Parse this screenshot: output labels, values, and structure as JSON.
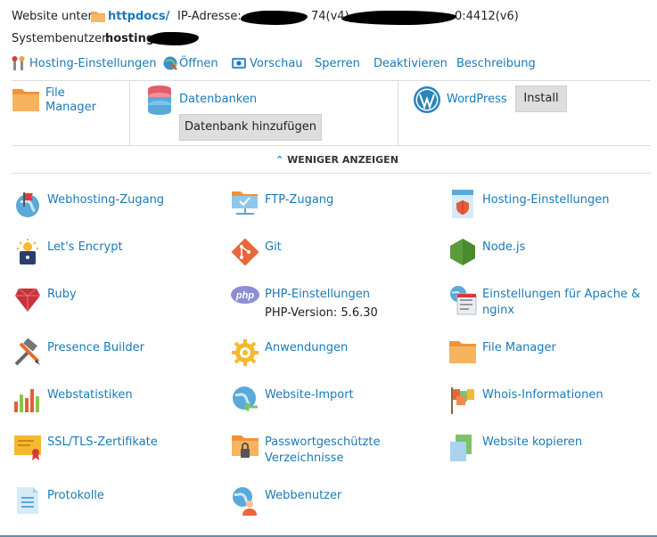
{
  "header": {
    "website_label": "Website unter",
    "httpdocs_link": "httpdocs/",
    "ip_label": "IP-Adresse:",
    "ip_v4_suffix": "74(v4),",
    "ip_v6_suffix": "0:4412(v6)",
    "sysuser_label": "Systembenutzer:",
    "sysuser_value": "hosting"
  },
  "toolbar": {
    "hosting": "Hosting-Einstellungen",
    "open": "Öffnen",
    "preview": "Vorschau",
    "lock": "Sperren",
    "deactivate": "Deaktivieren",
    "description": "Beschreibung"
  },
  "quick": {
    "file_manager_l1": "File",
    "file_manager_l2": "Manager",
    "databases": "Datenbanken",
    "add_db": "Datenbank hinzufügen",
    "wordpress": "WordPress",
    "install": "Install"
  },
  "toggle": {
    "label": "WENIGER ANZEIGEN"
  },
  "features": {
    "webhosting": "Webhosting-Zugang",
    "ftp": "FTP-Zugang",
    "hosting_settings": "Hosting-Einstellungen",
    "letsencrypt": "Let's Encrypt",
    "git": "Git",
    "nodejs": "Node.js",
    "ruby": "Ruby",
    "php": "PHP-Einstellungen",
    "php_version": "PHP-Version: 5.6.30",
    "apache_l1": "Einstellungen für Apache &",
    "apache_l2": "nginx",
    "presence": "Presence Builder",
    "apps": "Anwendungen",
    "filemanager": "File Manager",
    "webstats": "Webstatistiken",
    "import": "Website-Import",
    "whois": "Whois-Informationen",
    "ssl": "SSL/TLS-Zertifikate",
    "pw_dirs_l1": "Passwortgeschützte",
    "pw_dirs_l2": "Verzeichnisse",
    "copy": "Website kopieren",
    "logs": "Protokolle",
    "webusers": "Webbenutzer",
    "php_icon_text": "php"
  }
}
